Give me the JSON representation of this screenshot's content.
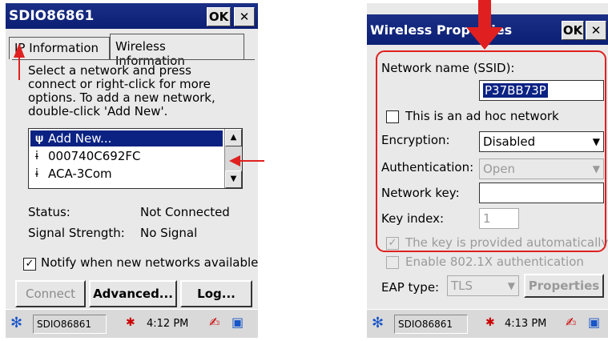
{
  "left": {
    "title": "SDIO86861",
    "ok_label": "OK",
    "close_label": "✕",
    "tabs": [
      "IP Information",
      "Wireless Information"
    ],
    "instructions": "Select a network and press connect or right-click for more options.  To add a new network, double-click 'Add New'.",
    "networks": [
      {
        "label": "Add New...",
        "icon": "antenna-icon",
        "selected": true
      },
      {
        "label": "000740C692FC",
        "icon": "signal-icon",
        "selected": false
      },
      {
        "label": "ACA-3Com",
        "icon": "signal-icon",
        "selected": false
      }
    ],
    "status_label": "Status:",
    "status_value": "Not Connected",
    "strength_label": "Signal Strength:",
    "strength_value": "No Signal",
    "notify_label": "Notify when new networks available",
    "buttons": [
      "Connect",
      "Advanced...",
      "Log..."
    ],
    "taskbar_app": "SDIO86861",
    "time": "4:12 PM"
  },
  "right": {
    "title": "Wireless Properties",
    "ok_label": "OK",
    "close_label": "✕",
    "ssid_label": "Network name (SSID):",
    "ssid_value": "P37BB73P",
    "adhoc_label": "This is an ad hoc network",
    "encryption_label": "Encryption:",
    "encryption_value": "Disabled",
    "auth_label": "Authentication:",
    "auth_value": "Open",
    "key_label": "Network key:",
    "key_value": "",
    "index_label": "Key index:",
    "index_value": "1",
    "key_auto_label": "The key is provided automatically",
    "dot1x_label": "Enable 802.1X authentication",
    "eap_label": "EAP type:",
    "eap_value": "TLS",
    "properties_label": "Properties",
    "taskbar_app": "SDIO86861",
    "time": "4:13 PM"
  },
  "colors": {
    "titlebar": "#0b1f74",
    "annotation": "#e02020",
    "selection": "#0b2283"
  }
}
